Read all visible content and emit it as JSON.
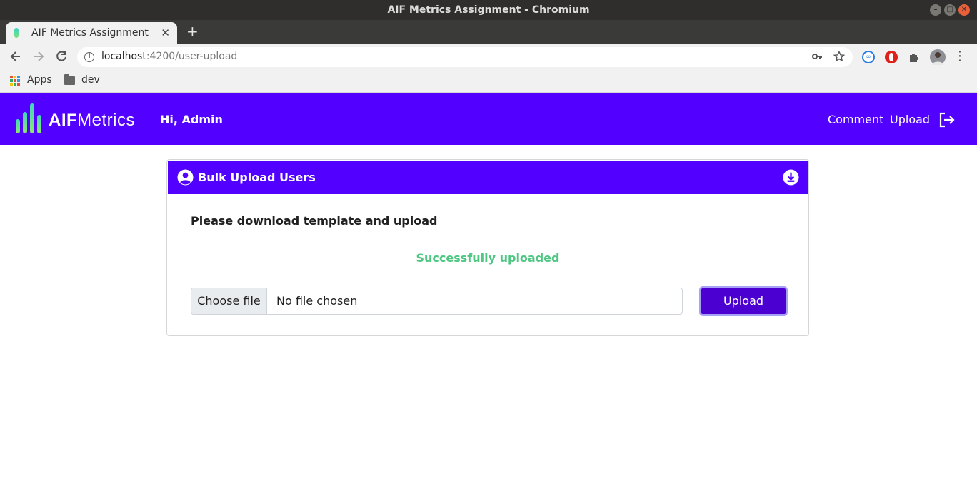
{
  "window": {
    "title": "AIF Metrics Assignment - Chromium"
  },
  "browser": {
    "tab_title": "AIF Metrics Assignment",
    "tab_close": "✕",
    "new_tab": "+",
    "url_host": "localhost",
    "url_path": ":4200/user-upload",
    "bookmarks": [
      {
        "label": "Apps",
        "icon": "apps-grid-icon"
      },
      {
        "label": "dev",
        "icon": "folder-icon"
      }
    ]
  },
  "navbar": {
    "logo_bold": "AIF",
    "logo_light": "Metrics",
    "greeting": "Hi, Admin",
    "links": [
      "Comment",
      "Upload"
    ],
    "logout_icon": "logout-icon",
    "background": "#5200ff"
  },
  "card": {
    "title": "Bulk Upload Users",
    "header_icon": "user-circle-icon",
    "action_icon": "download-icon",
    "instructions": "Please download template and upload",
    "status": "Successfully uploaded",
    "status_color": "#4fc783",
    "file_button": "Choose file",
    "file_label": "No file chosen",
    "submit": "Upload"
  }
}
